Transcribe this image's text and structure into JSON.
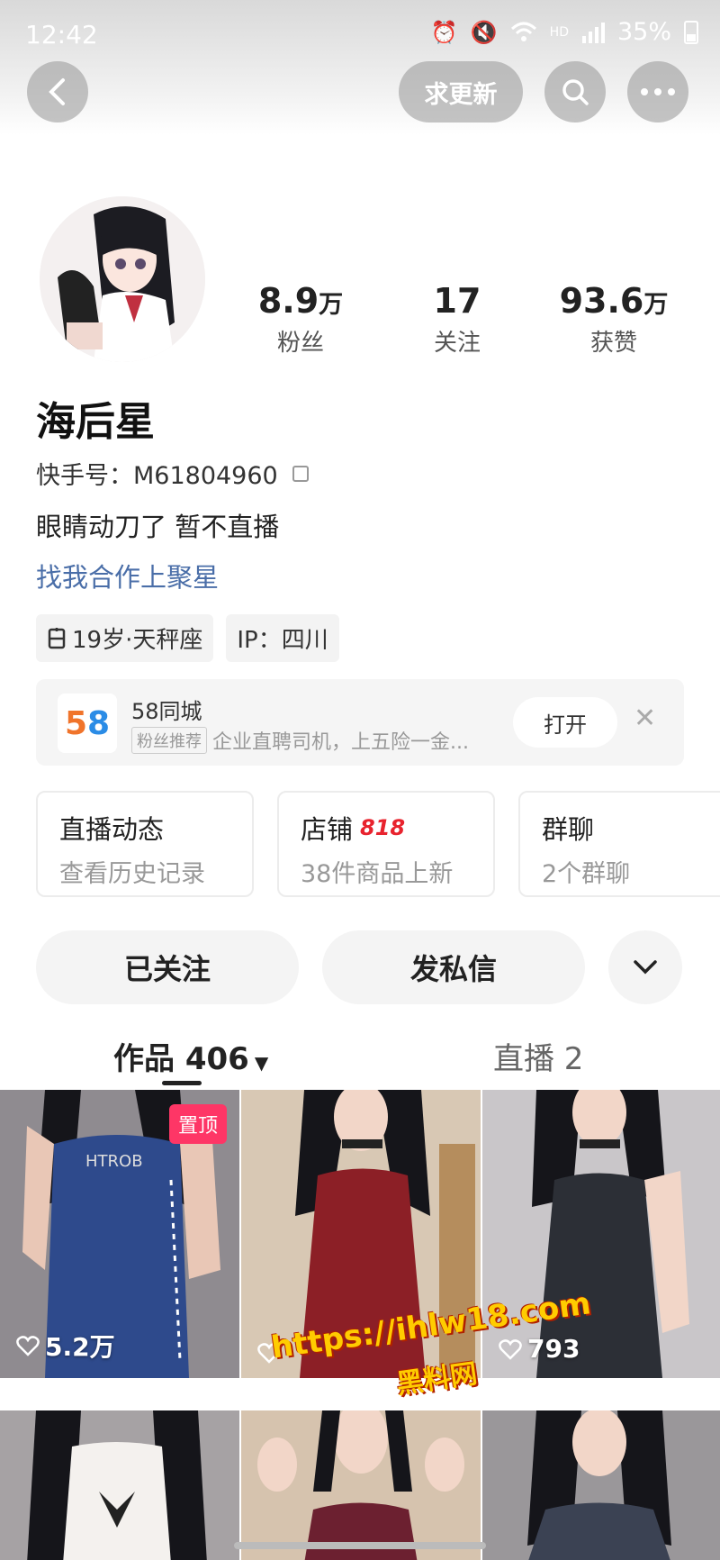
{
  "status_bar": {
    "time": "12:42",
    "network": "HD",
    "battery": "35%"
  },
  "nav": {
    "update_label": "求更新"
  },
  "profile": {
    "followers_num": "8.9",
    "followers_unit": "万",
    "followers_label": "粉丝",
    "following_num": "17",
    "following_label": "关注",
    "likes_num": "93.6",
    "likes_unit": "万",
    "likes_label": "获赞",
    "nickname": "海后星",
    "uid": "快手号：M61804960",
    "bio": "眼睛动刀了 暂不直播",
    "coop_link": "找我合作上聚星",
    "tags": [
      "19岁·天秤座",
      "IP：四川"
    ]
  },
  "ad": {
    "logo_5": "5",
    "logo_8": "8",
    "title": "58同城",
    "badge": "粉丝推荐",
    "desc": "企业直聘司机，上五险一金...",
    "open_label": "打开",
    "close_label": "✕"
  },
  "cards": [
    {
      "title": "直播动态",
      "sub": "查看历史记录"
    },
    {
      "title": "店铺",
      "badge": "818",
      "sub": "38件商品上新"
    },
    {
      "title": "群聊",
      "sub": "2个群聊"
    }
  ],
  "actions": {
    "followed": "已关注",
    "message": "发私信"
  },
  "tabs": {
    "works": "作品 406",
    "live": "直播 2"
  },
  "grid": [
    {
      "likes": "5.2万",
      "pinned": "置顶"
    },
    {
      "likes": ""
    },
    {
      "likes": "793"
    }
  ],
  "watermark": {
    "url": "https://ihlw18.com",
    "name": "黑料网"
  },
  "colors": {
    "pin": "#fe3666",
    "link": "#4a6ea8",
    "badge818": "#e8232e"
  }
}
